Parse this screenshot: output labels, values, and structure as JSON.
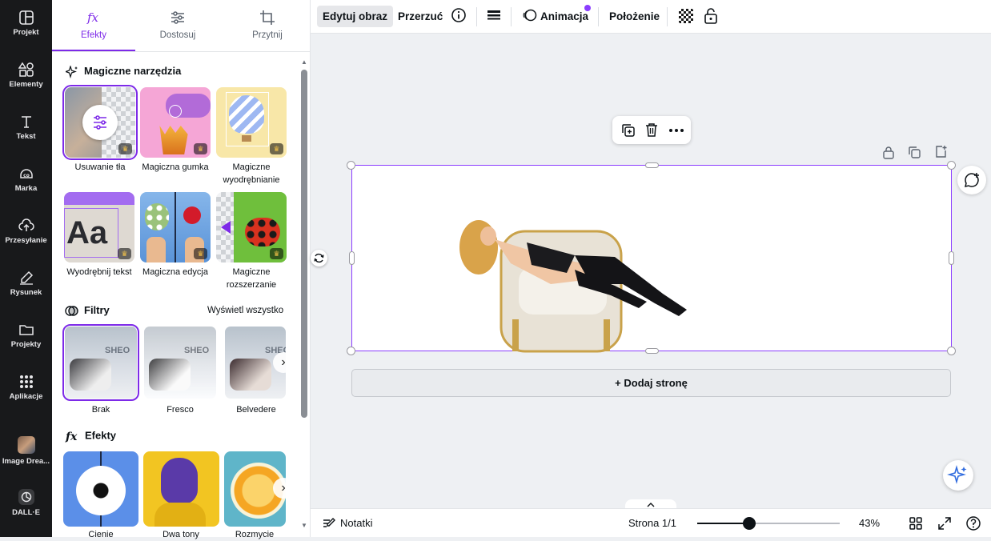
{
  "rail": {
    "items": [
      {
        "label": "Projekt",
        "icon": "layout-icon"
      },
      {
        "label": "Elementy",
        "icon": "shapes-icon"
      },
      {
        "label": "Tekst",
        "icon": "text-icon"
      },
      {
        "label": "Marka",
        "icon": "brand-icon"
      },
      {
        "label": "Przesyłanie",
        "icon": "cloud-upload-icon"
      },
      {
        "label": "Rysunek",
        "icon": "pen-icon"
      },
      {
        "label": "Projekty",
        "icon": "folder-icon"
      },
      {
        "label": "Aplikacje",
        "icon": "apps-grid-icon"
      },
      {
        "label": "Image Drea...",
        "icon": "app-thumbnail"
      },
      {
        "label": "DALL·E",
        "icon": "openai-icon"
      }
    ]
  },
  "panel": {
    "tabs": [
      {
        "label": "Efekty",
        "icon": "fx-icon",
        "active": true
      },
      {
        "label": "Dostosuj",
        "icon": "sliders-icon",
        "active": false
      },
      {
        "label": "Przytnij",
        "icon": "crop-icon",
        "active": false
      }
    ],
    "magic": {
      "title": "Magiczne narzędzia",
      "tools": [
        {
          "label": "Usuwanie tła"
        },
        {
          "label": "Magiczna gumka"
        },
        {
          "label": "Magiczne wyodrębnianie"
        },
        {
          "label": "Wyodrębnij tekst"
        },
        {
          "label": "Magiczna edycja"
        },
        {
          "label": "Magiczne rozszerzanie"
        }
      ]
    },
    "filters": {
      "title": "Filtry",
      "see_all": "Wyświetl wszystko",
      "items": [
        {
          "label": "Brak"
        },
        {
          "label": "Fresco"
        },
        {
          "label": "Belvedere"
        }
      ]
    },
    "effects": {
      "title": "Efekty",
      "items": [
        {
          "label": "Cienie"
        },
        {
          "label": "Dwa tony"
        },
        {
          "label": "Rozmycie"
        }
      ]
    }
  },
  "toolbar": {
    "edit_image": "Edytuj obraz",
    "flip": "Przerzuć",
    "animate": "Animacja",
    "position": "Położenie"
  },
  "canvas": {
    "add_page": "+ Dodaj stronę"
  },
  "bottombar": {
    "notes": "Notatki",
    "page_indicator": "Strona 1/1",
    "zoom": "43%",
    "zoom_fraction": 0.43
  },
  "colors": {
    "accent": "#7d2ae8",
    "rail_bg": "#18191b"
  }
}
